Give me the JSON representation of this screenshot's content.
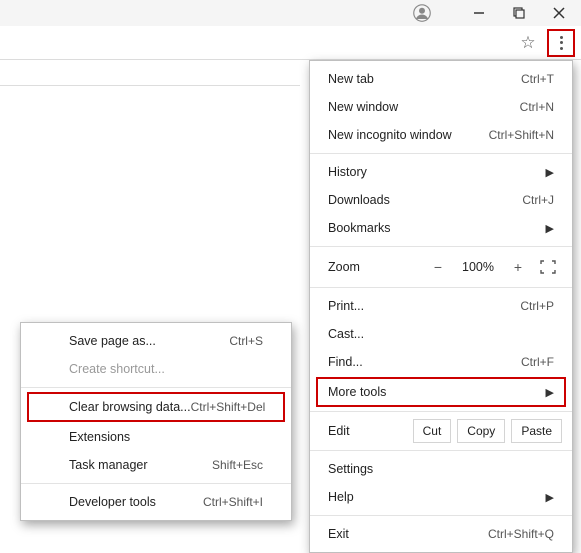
{
  "main_menu": {
    "new_tab": "New tab",
    "new_tab_sc": "Ctrl+T",
    "new_window": "New window",
    "new_window_sc": "Ctrl+N",
    "new_incognito": "New incognito window",
    "new_incognito_sc": "Ctrl+Shift+N",
    "history": "History",
    "downloads": "Downloads",
    "downloads_sc": "Ctrl+J",
    "bookmarks": "Bookmarks",
    "zoom": "Zoom",
    "zoom_minus": "−",
    "zoom_value": "100%",
    "zoom_plus": "+",
    "print": "Print...",
    "print_sc": "Ctrl+P",
    "cast": "Cast...",
    "find": "Find...",
    "find_sc": "Ctrl+F",
    "more_tools": "More tools",
    "edit": "Edit",
    "cut": "Cut",
    "copy": "Copy",
    "paste": "Paste",
    "settings": "Settings",
    "help": "Help",
    "exit": "Exit",
    "exit_sc": "Ctrl+Shift+Q"
  },
  "sub_menu": {
    "save_page": "Save page as...",
    "save_page_sc": "Ctrl+S",
    "create_shortcut": "Create shortcut...",
    "clear_browsing": "Clear browsing data...",
    "clear_browsing_sc": "Ctrl+Shift+Del",
    "extensions": "Extensions",
    "task_manager": "Task manager",
    "task_manager_sc": "Shift+Esc",
    "developer_tools": "Developer tools",
    "developer_tools_sc": "Ctrl+Shift+I"
  }
}
